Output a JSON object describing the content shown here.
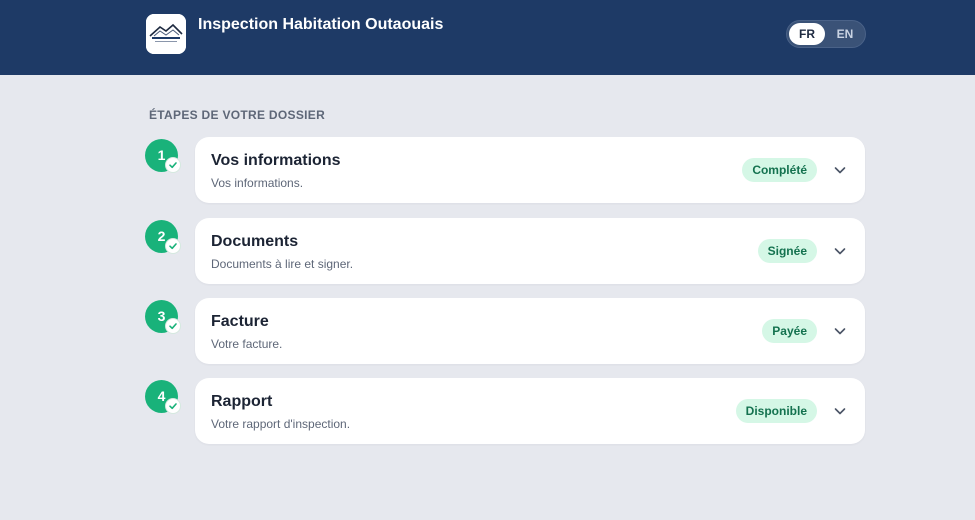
{
  "header": {
    "title": "Inspection Habitation Outaouais",
    "logo_icon": "house-logo-icon",
    "lang": {
      "fr": "FR",
      "en": "EN",
      "active": "FR"
    }
  },
  "steps_section": {
    "title": "ÉTAPES DE VOTRE DOSSIER",
    "steps": [
      {
        "number": "1",
        "title": "Vos informations",
        "subtitle": "Vos informations.",
        "status": "Complété"
      },
      {
        "number": "2",
        "title": "Documents",
        "subtitle": "Documents à lire et signer.",
        "status": "Signée"
      },
      {
        "number": "3",
        "title": "Facture",
        "subtitle": "Votre facture.",
        "status": "Payée"
      },
      {
        "number": "4",
        "title": "Rapport",
        "subtitle": "Votre rapport d'inspection.",
        "status": "Disponible"
      }
    ]
  },
  "colors": {
    "header_bg": "#1e3a66",
    "page_bg": "#e6e8ee",
    "step_green": "#19b27a",
    "badge_bg": "#d5f7e6",
    "badge_text": "#14724f"
  }
}
